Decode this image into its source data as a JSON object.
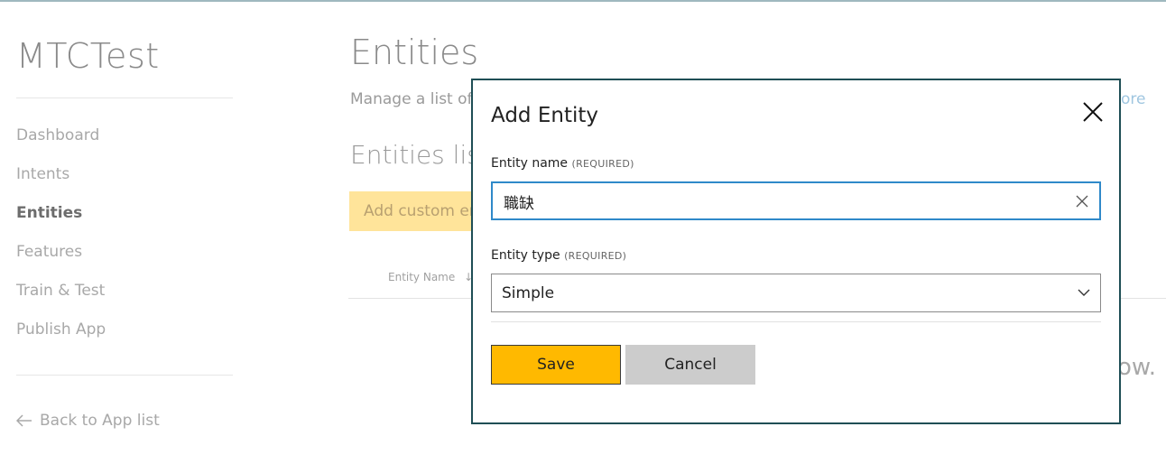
{
  "sidebar": {
    "app_title": "MTCTest",
    "items": [
      {
        "label": "Dashboard"
      },
      {
        "label": "Intents"
      },
      {
        "label": "Entities"
      },
      {
        "label": "Features"
      },
      {
        "label": "Train & Test"
      },
      {
        "label": "Publish App"
      }
    ],
    "active_item": "Entities",
    "back_label": "Back to App list"
  },
  "page": {
    "title": "Entities",
    "description_partial": "Manage a list of e",
    "learn_more_partial": "ore",
    "list_title_partial": "Entities list",
    "add_button_partial": "Add custom en",
    "column_entity_name": "Entity Name",
    "empty_message_partial": "ow."
  },
  "dialog": {
    "title": "Add Entity",
    "entity_name_label": "Entity name",
    "entity_name_required": "(REQUIRED)",
    "entity_name_value": "職缺",
    "entity_type_label": "Entity type",
    "entity_type_required": "(REQUIRED)",
    "entity_type_value": "Simple",
    "save_label": "Save",
    "cancel_label": "Cancel"
  },
  "colors": {
    "save_button": "#ffb900",
    "cancel_button": "#cccccc",
    "dialog_border": "#1f4e55",
    "input_focus_border": "#2f89c9",
    "add_button_bg": "#ffe49a"
  }
}
